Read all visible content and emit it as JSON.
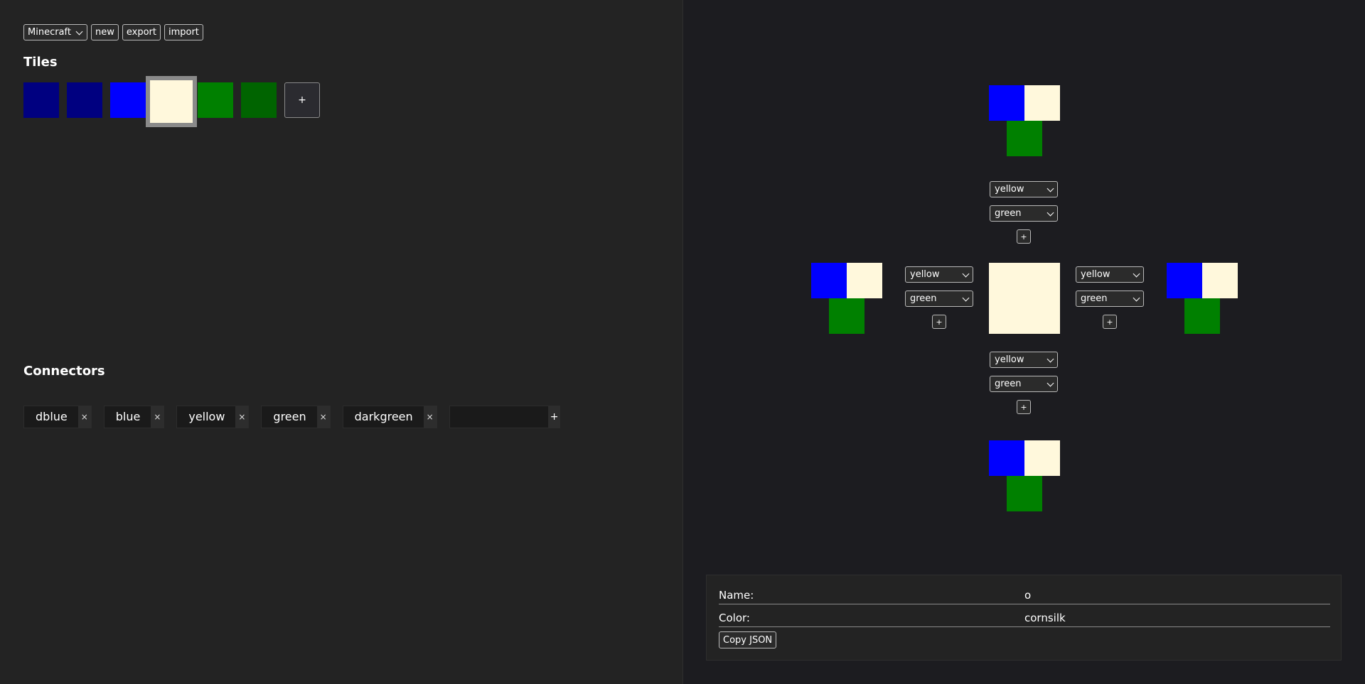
{
  "toolbar": {
    "preset_select": "Minecraft",
    "new_label": "new",
    "export_label": "export",
    "import_label": "import"
  },
  "tiles": {
    "title": "Tiles",
    "items": [
      {
        "color": "#000080"
      },
      {
        "color": "#000080"
      },
      {
        "color": "#0000ff"
      },
      {
        "color": "#fff8dc",
        "selected": true
      },
      {
        "color": "#008000"
      },
      {
        "color": "#006400"
      }
    ],
    "add_label": "+"
  },
  "connectors": {
    "title": "Connectors",
    "items": [
      "dblue",
      "blue",
      "yellow",
      "green",
      "darkgreen"
    ],
    "remove_label": "×",
    "add_label": "+"
  },
  "editor": {
    "selects": {
      "top": [
        "yellow",
        "green"
      ],
      "left": [
        "yellow",
        "green"
      ],
      "right": [
        "yellow",
        "green"
      ],
      "bottom": [
        "yellow",
        "green"
      ]
    },
    "add_label": "+",
    "colors": {
      "blue": "#0000ff",
      "cornsilk": "#fff8dc",
      "green": "#008000"
    }
  },
  "info": {
    "name_label": "Name:",
    "name_value": "o",
    "color_label": "Color:",
    "color_value": "cornsilk",
    "copy_label": "Copy JSON"
  }
}
